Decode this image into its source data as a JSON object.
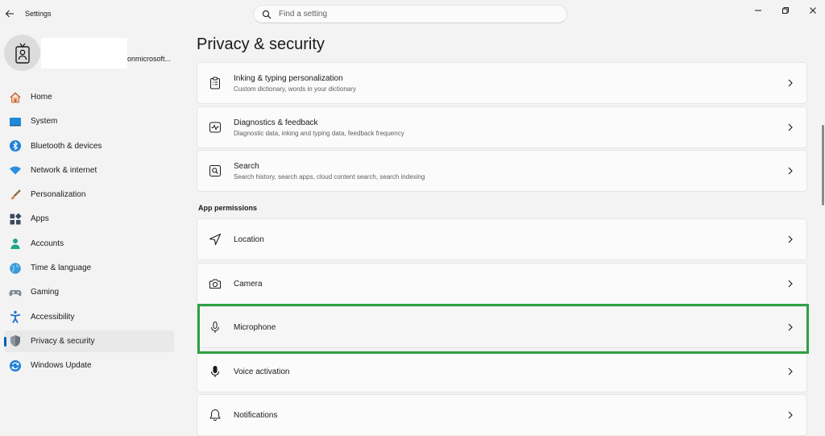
{
  "titlebar": {
    "app_title": "Settings"
  },
  "search": {
    "placeholder": "Find a setting"
  },
  "profile": {
    "email_suffix": "onmicrosoft..."
  },
  "sidebar": {
    "items": [
      {
        "label": "Home",
        "icon": "home-icon"
      },
      {
        "label": "System",
        "icon": "system-icon"
      },
      {
        "label": "Bluetooth & devices",
        "icon": "bluetooth-icon"
      },
      {
        "label": "Network & internet",
        "icon": "wifi-icon"
      },
      {
        "label": "Personalization",
        "icon": "brush-icon"
      },
      {
        "label": "Apps",
        "icon": "apps-icon"
      },
      {
        "label": "Accounts",
        "icon": "accounts-icon"
      },
      {
        "label": "Time & language",
        "icon": "globe-icon"
      },
      {
        "label": "Gaming",
        "icon": "gamepad-icon"
      },
      {
        "label": "Accessibility",
        "icon": "accessibility-icon"
      },
      {
        "label": "Privacy & security",
        "icon": "shield-icon",
        "active": true
      },
      {
        "label": "Windows Update",
        "icon": "update-icon"
      }
    ]
  },
  "main": {
    "page_title": "Privacy & security",
    "cards_top": [
      {
        "title": "Inking & typing personalization",
        "desc": "Custom dictionary, words in your dictionary",
        "icon": "clipboard-icon"
      },
      {
        "title": "Diagnostics & feedback",
        "desc": "Diagnostic data, inking and typing data, feedback frequency",
        "icon": "diagnostics-icon"
      },
      {
        "title": "Search",
        "desc": "Search history, search apps, cloud content search, search indexing",
        "icon": "search-box-icon"
      }
    ],
    "section_header": "App permissions",
    "permissions": [
      {
        "title": "Location",
        "icon": "location-icon"
      },
      {
        "title": "Camera",
        "icon": "camera-icon"
      },
      {
        "title": "Microphone",
        "icon": "microphone-icon",
        "highlighted": true
      },
      {
        "title": "Voice activation",
        "icon": "voice-activation-icon"
      },
      {
        "title": "Notifications",
        "icon": "bell-icon"
      }
    ]
  },
  "colors": {
    "accent": "#005fb8",
    "highlight": "#2ea043",
    "background": "#f3f3f3",
    "card": "#fbfbfb"
  }
}
